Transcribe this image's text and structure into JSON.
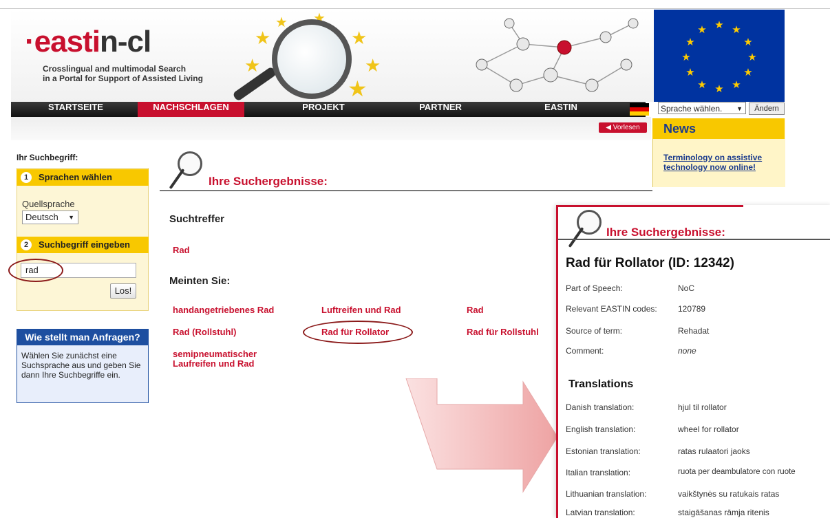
{
  "brand": {
    "logo_prefix": "·east",
    "logo_mark": "i",
    "logo_suffix": "n-cl",
    "tagline_1": "Crosslingual and multimodal Search",
    "tagline_2": "in a Portal for Support of Assisted Living"
  },
  "nav": {
    "items": [
      {
        "label": "STARTSEITE",
        "active": false
      },
      {
        "label": "NACHSCHLAGEN",
        "active": true
      },
      {
        "label": "PROJEKT",
        "active": false
      },
      {
        "label": "PARTNER",
        "active": false
      },
      {
        "label": "EASTIN",
        "active": false
      }
    ],
    "language_select": "Sprache wählen.",
    "change_button": "Ändern",
    "read_aloud": "Vorlesen"
  },
  "news": {
    "title": "News",
    "link": "Terminology on assistive technology now online!"
  },
  "sidebar": {
    "search_term_label": "Ihr Suchbegriff:",
    "step1": {
      "num": "1",
      "label": "Sprachen wählen"
    },
    "source_lang_label": "Quellsprache",
    "source_lang_value": "Deutsch",
    "step2": {
      "num": "2",
      "label": "Suchbegriff eingeben"
    },
    "search_value": "rad",
    "go_button": "Los!",
    "help_title": "Wie stellt man Anfragen?",
    "help_text": "Wählen Sie zunächst eine Suchsprache aus und geben Sie dann Ihre Suchbegriffe ein."
  },
  "results": {
    "heading": "Ihre Suchergebnisse:",
    "hits_label": "Suchtreffer",
    "hit": "Rad",
    "did_you_mean": "Meinten Sie:",
    "suggestions": [
      "handangetriebenes Rad",
      "Luftreifen und Rad",
      "Rad",
      "Rad (Rollstuhl)",
      "Rad für Rollator",
      "Rad für Rollstuhl",
      "semipneumatischer Laufreifen und Rad"
    ]
  },
  "detail": {
    "heading": "Ihre Suchergebnisse:",
    "title": "Rad für Rollator (ID: 12342)",
    "fields": [
      {
        "label": "Part of Speech:",
        "value": "NoC"
      },
      {
        "label": "Relevant EASTIN codes:",
        "value": "120789"
      },
      {
        "label": "Source of term:",
        "value": "Rehadat"
      },
      {
        "label": "Comment:",
        "value": "none"
      }
    ],
    "translations_title": "Translations",
    "translations": [
      {
        "label": "Danish translation:",
        "value": "hjul til rollator"
      },
      {
        "label": "English translation:",
        "value": "wheel for rollator"
      },
      {
        "label": "Estonian translation:",
        "value": "ratas rulaatori jaoks"
      },
      {
        "label": "Italian translation:",
        "value": "ruota per deambulatore con ruote"
      },
      {
        "label": "Lithuanian translation:",
        "value": "vaikštynės su ratukais ratas"
      },
      {
        "label": "Latvian translation:",
        "value": "staigāšanas rāmja ritenis"
      }
    ]
  },
  "colors": {
    "accent": "#c8102e",
    "yellow": "#f8c800",
    "blue": "#1e4fa0"
  }
}
